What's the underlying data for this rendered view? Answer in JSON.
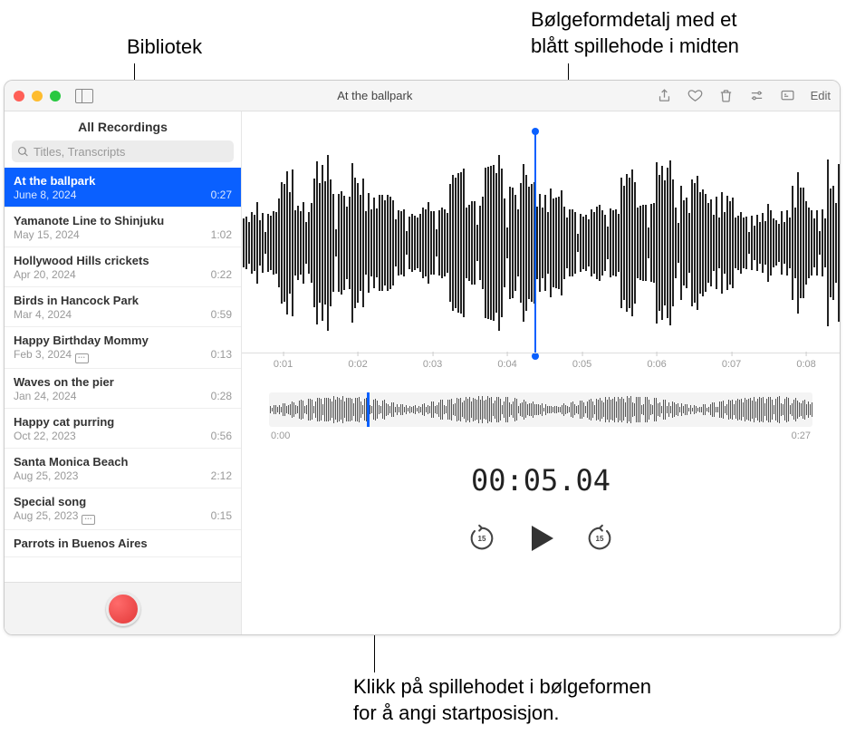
{
  "callouts": {
    "library": "Bibliotek",
    "waveform_detail_line1": "Bølgeformdetalj med et",
    "waveform_detail_line2": "blått spillehode i midten",
    "overview_hint_line1": "Klikk på spillehodet i bølgeformen",
    "overview_hint_line2": "for å angi startposisjon."
  },
  "titlebar": {
    "title": "At the ballpark",
    "edit": "Edit"
  },
  "sidebar": {
    "header": "All Recordings",
    "search_placeholder": "Titles, Transcripts"
  },
  "recordings": [
    {
      "title": "At the ballpark",
      "date": "June 8, 2024",
      "duration": "0:27",
      "selected": true,
      "badge": false
    },
    {
      "title": "Yamanote Line to Shinjuku",
      "date": "May 15, 2024",
      "duration": "1:02",
      "selected": false,
      "badge": false
    },
    {
      "title": "Hollywood Hills crickets",
      "date": "Apr 20, 2024",
      "duration": "0:22",
      "selected": false,
      "badge": false
    },
    {
      "title": "Birds in Hancock Park",
      "date": "Mar 4, 2024",
      "duration": "0:59",
      "selected": false,
      "badge": false
    },
    {
      "title": "Happy Birthday Mommy",
      "date": "Feb 3, 2024",
      "duration": "0:13",
      "selected": false,
      "badge": true
    },
    {
      "title": "Waves on the pier",
      "date": "Jan 24, 2024",
      "duration": "0:28",
      "selected": false,
      "badge": false
    },
    {
      "title": "Happy cat purring",
      "date": "Oct 22, 2023",
      "duration": "0:56",
      "selected": false,
      "badge": false
    },
    {
      "title": "Santa Monica Beach",
      "date": "Aug 25, 2023",
      "duration": "2:12",
      "selected": false,
      "badge": false
    },
    {
      "title": "Special song",
      "date": "Aug 25, 2023",
      "duration": "0:15",
      "selected": false,
      "badge": true
    },
    {
      "title": "Parrots in Buenos Aires",
      "date": "",
      "duration": "",
      "selected": false,
      "badge": false
    }
  ],
  "detail": {
    "ticks": [
      "0:01",
      "0:02",
      "0:03",
      "0:04",
      "0:05",
      "0:06",
      "0:07",
      "0:08"
    ],
    "playhead_pct": 49,
    "overview_start": "0:00",
    "overview_end": "0:27",
    "overview_playhead_pct": 18,
    "timecode": "00:05.04",
    "skip_seconds": "15"
  }
}
